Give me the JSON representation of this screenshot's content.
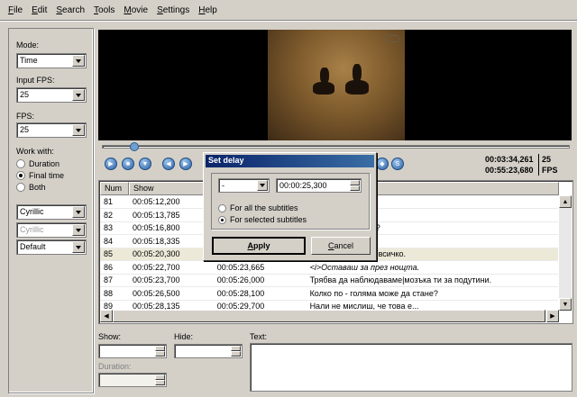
{
  "menu": [
    {
      "acc": "F",
      "rest": "ile"
    },
    {
      "acc": "E",
      "rest": "dit"
    },
    {
      "acc": "S",
      "rest": "earch"
    },
    {
      "acc": "T",
      "rest": "ools"
    },
    {
      "acc": "M",
      "rest": "ovie"
    },
    {
      "acc": "S",
      "rest": "ettings"
    },
    {
      "acc": "H",
      "rest": "elp"
    }
  ],
  "left": {
    "mode_label": "Mode:",
    "mode_value": "Time",
    "input_fps_label": "Input FPS:",
    "input_fps_value": "25",
    "fps_label": "FPS:",
    "fps_value": "25",
    "work_with_label": "Work with:",
    "work_options": [
      "Duration",
      "Final time",
      "Both"
    ],
    "work_selected": "Final time",
    "charset1": "Cyrillic",
    "charset2": "Cyrillic",
    "style": "Default"
  },
  "player": {
    "current_time": "00:03:34,261",
    "total_time": "00:55:23,680",
    "fps": "25",
    "fps_unit": "FPS",
    "seek_position_fraction": 0.07
  },
  "grid": {
    "columns": [
      "Num",
      "Show",
      "",
      ""
    ],
    "rows": [
      {
        "num": "81",
        "show": "00:05:12,200",
        "hide": "",
        "text": "на и мотоциклета."
      },
      {
        "num": "82",
        "show": "00:05:13,785",
        "hide": "",
        "text": "ходил снощи."
      },
      {
        "num": "83",
        "show": "00:05:16,800",
        "hide": "",
        "text": "на и мотоциклета?"
      },
      {
        "num": "84",
        "show": "00:05:18,335",
        "hide": "",
        "text": "ощи?"
      },
      {
        "num": "85",
        "show": "00:05:20,300",
        "hide": "",
        "text": "ш ли?|Аз лъжа за всичко."
      },
      {
        "num": "86",
        "show": "00:05:22,700",
        "hide": "00:05:23,665",
        "text": "<i>Оставаш за през нощта."
      },
      {
        "num": "87",
        "show": "00:05:23,700",
        "hide": "00:05:26,000",
        "text": "Трябва да наблюдаваме|мозъка ти за подутини."
      },
      {
        "num": "88",
        "show": "00:05:26,500",
        "hide": "00:05:28,100",
        "text": "Колко по - голяма може да стане?"
      },
      {
        "num": "89",
        "show": "00:05:28,135",
        "hide": "00:05:29,700",
        "text": "Нали не мислиш, че това е..."
      }
    ],
    "selected_num": "85"
  },
  "bottom": {
    "show_label": "Show:",
    "hide_label": "Hide:",
    "duration_label": "Duration:",
    "text_label": "Text:"
  },
  "dialog": {
    "title": "Set delay",
    "sign": "-",
    "delay": "00:00:25,300",
    "option_all": "For all the subtitles",
    "option_selected": "For selected subtitles",
    "selected_option": "For selected subtitles",
    "apply_acc": "A",
    "apply_rest": "pply",
    "cancel_acc": "C",
    "cancel_rest": "ancel"
  },
  "colors": {
    "window_bg": "#d4d0c8",
    "title_bar": "#0a246a",
    "seek_thumb": "#6e9fd0",
    "scroll_marker": "#cc0000"
  }
}
